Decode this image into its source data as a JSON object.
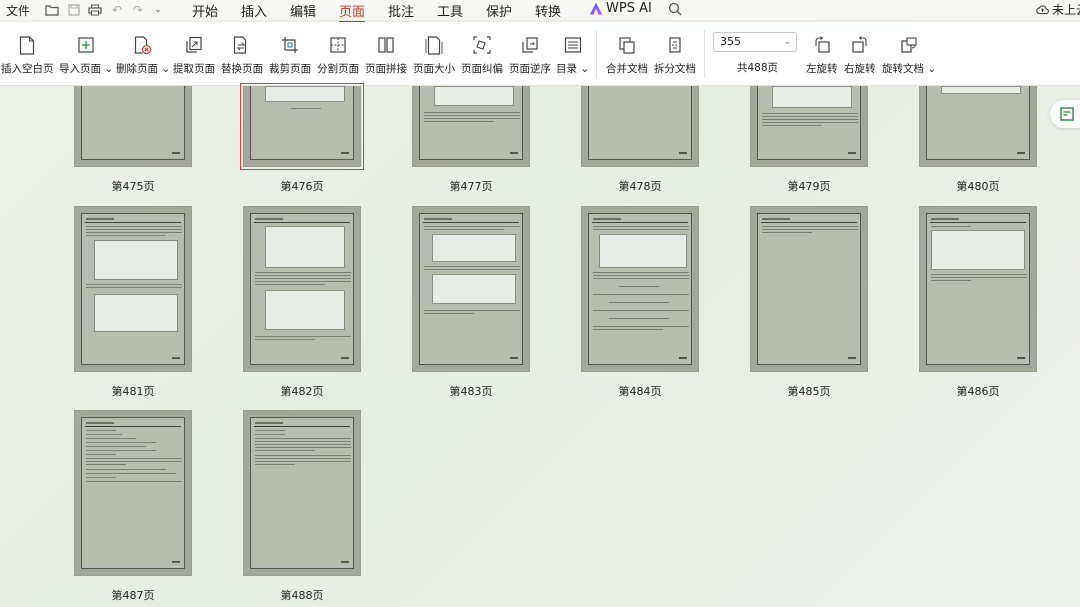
{
  "menu": {
    "file": "文件",
    "tabs": [
      "开始",
      "插入",
      "编辑",
      "页面",
      "批注",
      "工具",
      "保护",
      "转换"
    ],
    "active_tab": "页面",
    "wps_ai": "WPS AI",
    "cloud": "未上云"
  },
  "ribbon": {
    "insert_blank": "插入空白页",
    "import_page": "导入页面",
    "delete_page": "删除页面",
    "extract_page": "提取页面",
    "replace_page": "替换页面",
    "crop_page": "裁剪页面",
    "split_page": "分割页面",
    "page_join": "页面拼接",
    "page_size": "页面大小",
    "page_deskew": "页面纠偏",
    "page_reverse": "页面逆序",
    "toc": "目录",
    "merge_doc": "合并文档",
    "split_doc": "拆分文档",
    "current_page": "355",
    "total_pages": "共488页",
    "rotate_left": "左旋转",
    "rotate_right": "右旋转",
    "rotate_doc": "旋转文档"
  },
  "colors": {
    "accent": "#c0392b",
    "selected_border": "#e03a3a"
  },
  "thumbnails": {
    "p475": "第475页",
    "p476": "第476页",
    "p477": "第477页",
    "p478": "第478页",
    "p479": "第479页",
    "p480": "第480页",
    "p481": "第481页",
    "p482": "第482页",
    "p483": "第483页",
    "p484": "第484页",
    "p485": "第485页",
    "p486": "第486页",
    "p487": "第487页",
    "p488": "第488页",
    "selected": "第476页"
  }
}
